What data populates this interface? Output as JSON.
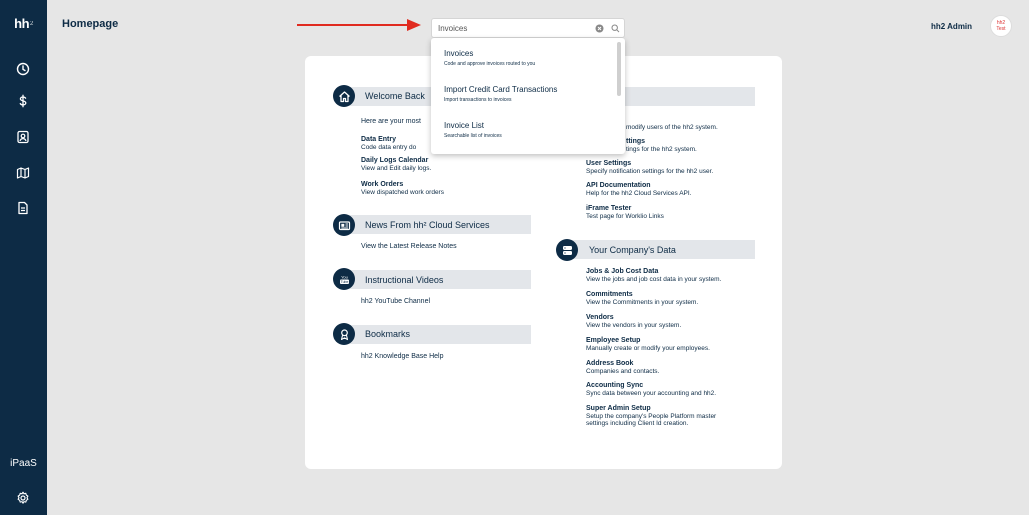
{
  "app": {
    "logo_text": "hh",
    "logo_sup": "2",
    "page_title": "Homepage",
    "admin_name": "hh2 Admin",
    "avatar_line1": "hh2",
    "avatar_line2": "Test",
    "ipaas_label": "iPaaS"
  },
  "sidebar": {
    "icons": [
      "clock-icon",
      "dollar-icon",
      "contact-card-icon",
      "map-icon",
      "document-icon",
      "settings-gear-icon"
    ]
  },
  "search": {
    "value": "Invoices",
    "placeholder": "Search"
  },
  "dropdown": {
    "items": [
      {
        "title": "Invoices",
        "subtitle": "Code and approve invoices routed to you"
      },
      {
        "title": "Import Credit Card Transactions",
        "subtitle": "Import transactions to invoices"
      },
      {
        "title": "Invoice List",
        "subtitle": "Searchable list of invoices"
      }
    ]
  },
  "welcome": {
    "title": "Welcome Back",
    "intro": "Here are your most",
    "links": [
      {
        "title": "Data Entry",
        "desc": "Code data entry do"
      },
      {
        "title": "Daily Logs Calendar",
        "desc": "View and Edit daily logs."
      },
      {
        "title": "Work Orders",
        "desc": "View dispatched work orders"
      }
    ]
  },
  "admin_links": [
    {
      "title": "",
      "desc": "modify users of the hh2 system."
    },
    {
      "title": "ttings",
      "desc": "tings for the hh2 system."
    },
    {
      "title": "User Settings",
      "desc": "Specify notification settings for the hh2 user."
    },
    {
      "title": "API Documentation",
      "desc": "Help for the hh2 Cloud Services API."
    },
    {
      "title": "iFrame Tester",
      "desc": "Test page for Worklio Links"
    }
  ],
  "news": {
    "title": "News From hh² Cloud Services",
    "link": "View the Latest Release Notes"
  },
  "videos": {
    "title": "Instructional Videos",
    "link": "hh2 YouTube Channel"
  },
  "bookmarks": {
    "title": "Bookmarks",
    "link": "hh2 Knowledge Base Help"
  },
  "company": {
    "title": "Your Company's Data",
    "links": [
      {
        "title": "Jobs & Job Cost Data",
        "desc": "View the jobs and job cost data in your system."
      },
      {
        "title": "Commitments",
        "desc": "View the Commitments in your system."
      },
      {
        "title": "Vendors",
        "desc": "View the vendors in your system."
      },
      {
        "title": "Employee Setup",
        "desc": "Manually create or modify your employees."
      },
      {
        "title": "Address Book",
        "desc": "Companies and contacts."
      },
      {
        "title": "Accounting Sync",
        "desc": "Sync data between your accounting and hh2."
      },
      {
        "title": "Super Admin Setup",
        "desc": "Setup the company's People Platform master",
        "desc2": "settings including Client Id creation."
      }
    ]
  },
  "colors": {
    "navy": "#0d2b45",
    "background": "#e6e6e6",
    "arrow": "#e02b20",
    "section_bar": "#e3e6ea"
  }
}
